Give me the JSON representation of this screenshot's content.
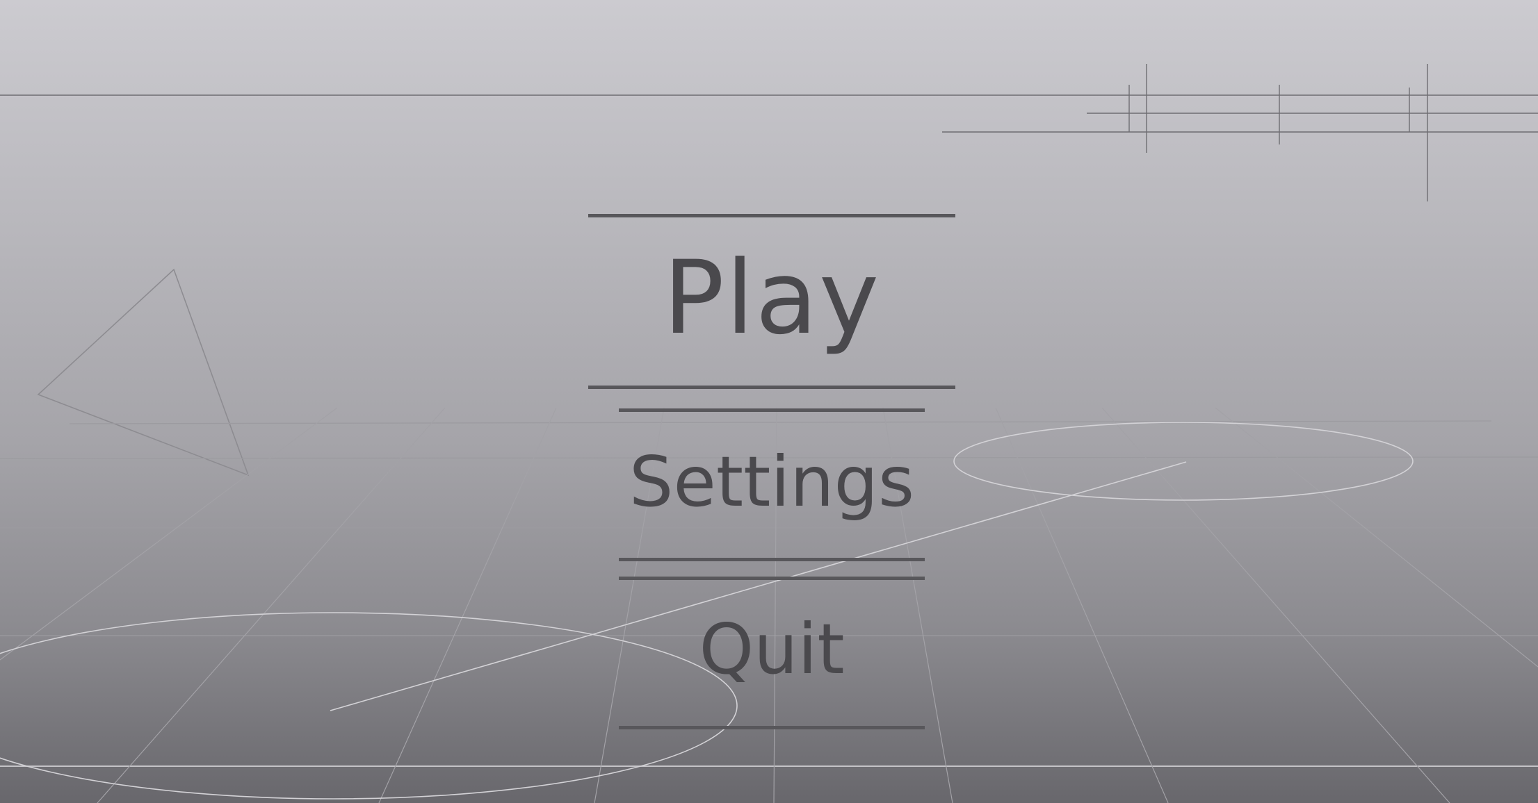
{
  "menu": {
    "play_label": "Play",
    "settings_label": "Settings",
    "quit_label": "Quit"
  },
  "colors": {
    "menu_text": "#4a494d",
    "menu_lines": "#58575b",
    "background_top": "#cccbd0",
    "background_bottom": "#68676c"
  }
}
